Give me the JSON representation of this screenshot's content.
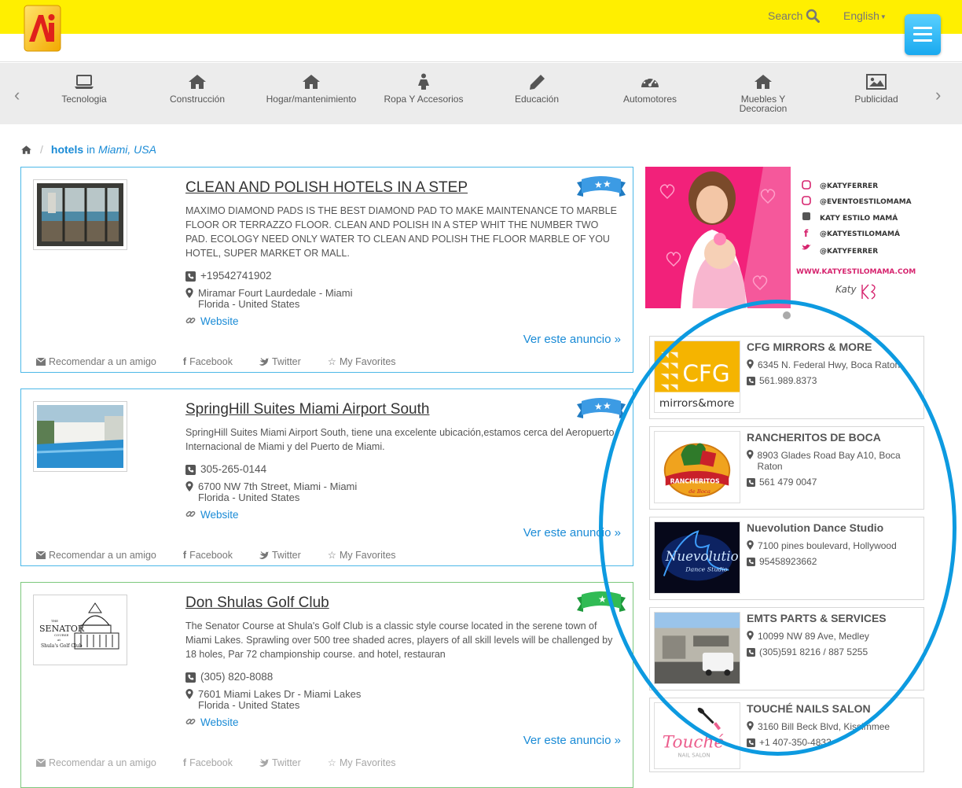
{
  "header": {
    "search_label": "Search",
    "language_label": "English",
    "colors": {
      "topbar": "#ffef00",
      "accent": "#1a8bd6",
      "menu_button": "#19a9ef"
    }
  },
  "categories": [
    {
      "label": "Tecnologia",
      "icon": "laptop-icon"
    },
    {
      "label": "Construcción",
      "icon": "home-icon"
    },
    {
      "label": "Hogar/mantenimiento",
      "icon": "home-icon"
    },
    {
      "label": "Ropa Y Accesorios",
      "icon": "person-icon"
    },
    {
      "label": "Educación",
      "icon": "pencil-icon"
    },
    {
      "label": "Automotores",
      "icon": "dashboard-icon"
    },
    {
      "label": "Muebles Y Decoracion",
      "icon": "home-icon"
    },
    {
      "label": "Publicidad",
      "icon": "picture-icon"
    }
  ],
  "breadcrumb": {
    "keyword": "hotels",
    "in": "in",
    "location": "Miami, USA"
  },
  "listings": [
    {
      "title": "CLEAN AND POLISH HOTELS IN A STEP",
      "description": "MAXIMO DIAMOND PADS IS THE BEST DIAMOND PAD TO MAKE MAINTENANCE TO MARBLE FLOOR OR TERRAZZO FLOOR. CLEAN AND POLISH IN A STEP WHIT THE NUMBER TWO PAD. ECOLOGY NEED ONLY WATER TO CLEAN AND POLISH THE FLOOR MARBLE OF YOU HOTEL, SUPER MARKET OR MALL.",
      "phone": "+19542741902",
      "address_line1": "Miramar Fourt Laurdedale - Miami",
      "address_line2": "Florida - United States",
      "website_label": "Website",
      "cta": "Ver este anuncio »"
    },
    {
      "title": "SpringHill Suites Miami Airport South",
      "description": "SpringHill Suites Miami Airport South, tiene una excelente ubicación,estamos cerca del Aeropuerto Internacional de Miami y del Puerto de Miami.",
      "phone": "305-265-0144",
      "address_line1": "6700 NW 7th Street, Miami - Miami",
      "address_line2": "Florida - United States",
      "website_label": "Website",
      "cta": "Ver este anuncio »"
    },
    {
      "title": "Don Shulas Golf Club",
      "description": "The Senator Course at Shula's Golf Club is a classic style course located in the serene town of Miami Lakes. Sprawling over 500 tree shaded acres, players of all skill levels will be challenged by 18 holes, Par 72 championship course. and hotel, restauran",
      "phone": "(305) 820-8088",
      "address_line1": "7601 Miami Lakes Dr - Miami Lakes",
      "address_line2": "Florida - United States",
      "website_label": "Website",
      "cta": "Ver este anuncio »",
      "logo_text": {
        "the": "THE",
        "senator": "SENATOR",
        "course": "COURSE",
        "at": "at",
        "club": "Shula's Golf Club"
      }
    }
  ],
  "actions": {
    "recommend": "Recomendar a un amigo",
    "facebook": "Facebook",
    "twitter": "Twitter",
    "favorites": "My Favorites"
  },
  "banner": {
    "social": [
      "@KATYFERRER",
      "@EVENTOESTILOMAMA",
      "KATY ESTILO MAMÁ",
      "@KATYESTILOMAMÁ",
      "@KATYFERRER"
    ],
    "url": "WWW.KATYESTILOMAMA.COM",
    "brand": "Katy"
  },
  "businesses": [
    {
      "name": "CFG MIRRORS & MORE",
      "address": "6345 N. Federal Hwy, Boca Raton",
      "phone": "561.989.8373",
      "logo_main": "CFG",
      "logo_sub": "mirrors&more"
    },
    {
      "name": "RANCHERITOS DE BOCA",
      "address": "8903 Glades Road Bay A10, Boca Raton",
      "phone": "561 479 0047",
      "logo_main": "RANCHERITOS",
      "logo_sub": "de Boca"
    },
    {
      "name": "Nuevolution Dance Studio",
      "address": "7100 pines boulevard, Hollywood",
      "phone": "95458923662",
      "logo_main": "Nuevolution",
      "logo_sub": "Dance Studio"
    },
    {
      "name": "EMTS PARTS & SERVICES",
      "address": "10099 NW 89 Ave, Medley",
      "phone": "(305)591 8216 / 887 5255"
    },
    {
      "name": "TOUCHÉ NAILS SALON",
      "address": "3160 Bill Beck Blvd, Kissimmee",
      "phone": "+1 407-350-4833",
      "logo_main": "Touché",
      "logo_sub": "NAIL SALON"
    }
  ]
}
